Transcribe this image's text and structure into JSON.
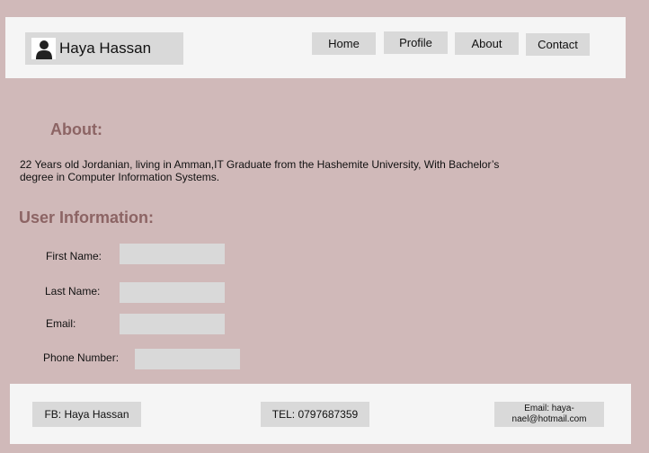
{
  "header": {
    "user_name": "Haya Hassan",
    "nav": [
      "Home",
      "Profile",
      "About",
      "Contact"
    ]
  },
  "about": {
    "title": "About:",
    "text": " 22 Years old Jordanian, living in Amman,IT Graduate from the Hashemite University, With Bachelor’s degree in Computer Information Systems."
  },
  "user_info": {
    "title": "User Information:",
    "fields": [
      {
        "label": "First Name:",
        "value": ""
      },
      {
        "label": "Last Name:",
        "value": ""
      },
      {
        "label": "Email:",
        "value": ""
      },
      {
        "label": "Phone Number:",
        "value": ""
      }
    ]
  },
  "footer": {
    "fb": "FB: Haya Hassan",
    "tel": "TEL: 0797687359",
    "email": "Email: haya-nael@hotmail.com"
  },
  "colors": {
    "background": "#d0b9b9",
    "panel": "#f5f5f5",
    "button": "#d9d9d9",
    "heading": "#8c6464"
  },
  "icons": {
    "avatar": "user-silhouette-icon"
  }
}
